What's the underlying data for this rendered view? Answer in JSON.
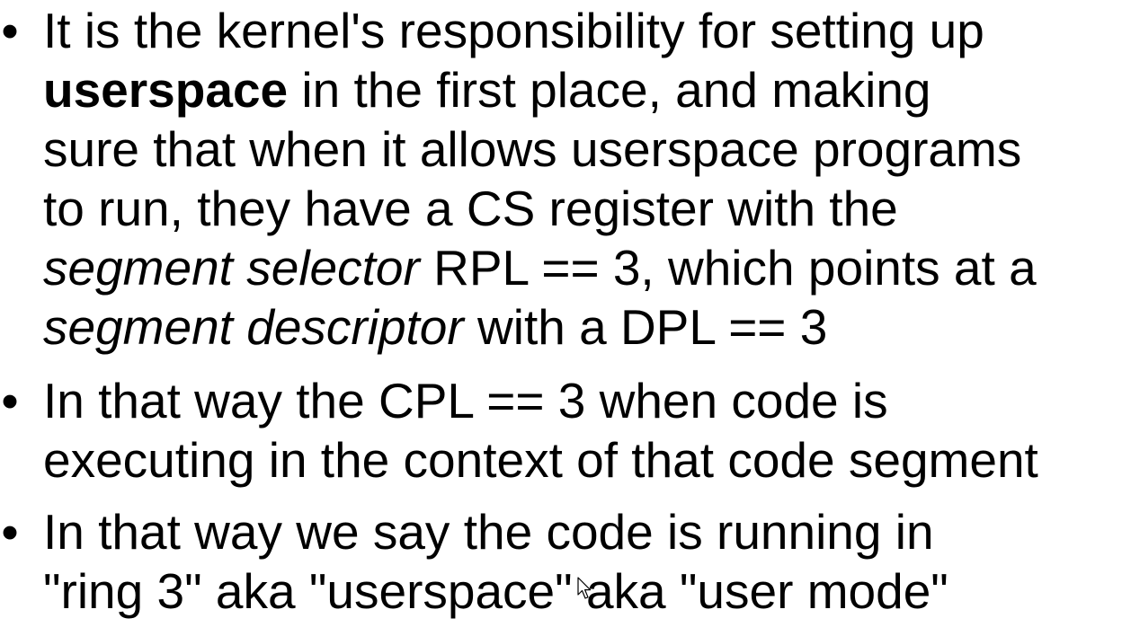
{
  "slide": {
    "bullet_glyph": "•",
    "bullets": [
      {
        "lines": [
          {
            "a": "It is the kernel's responsibility for setting up"
          },
          {
            "bold": "userspace",
            "rest": " in the first place, and making"
          },
          {
            "a": "sure that when it allows userspace programs"
          },
          {
            "a": "to run, they have a CS register with the"
          },
          {
            "italic": "segment selector",
            "rest": " RPL == 3, which points at a"
          },
          {
            "italic": "segment descriptor",
            "rest": " with a DPL == 3"
          }
        ]
      },
      {
        "lines": [
          {
            "a": "In that way the CPL == 3 when code is"
          },
          {
            "a": "executing in the context of that code segment"
          }
        ]
      },
      {
        "lines": [
          {
            "a": "In that way we say the code is running in"
          },
          {
            "a": "\"ring 3\" aka \"userspace\" aka \"user mode\""
          }
        ]
      }
    ]
  },
  "cursor": {
    "icon": "mouse-pointer-icon"
  }
}
